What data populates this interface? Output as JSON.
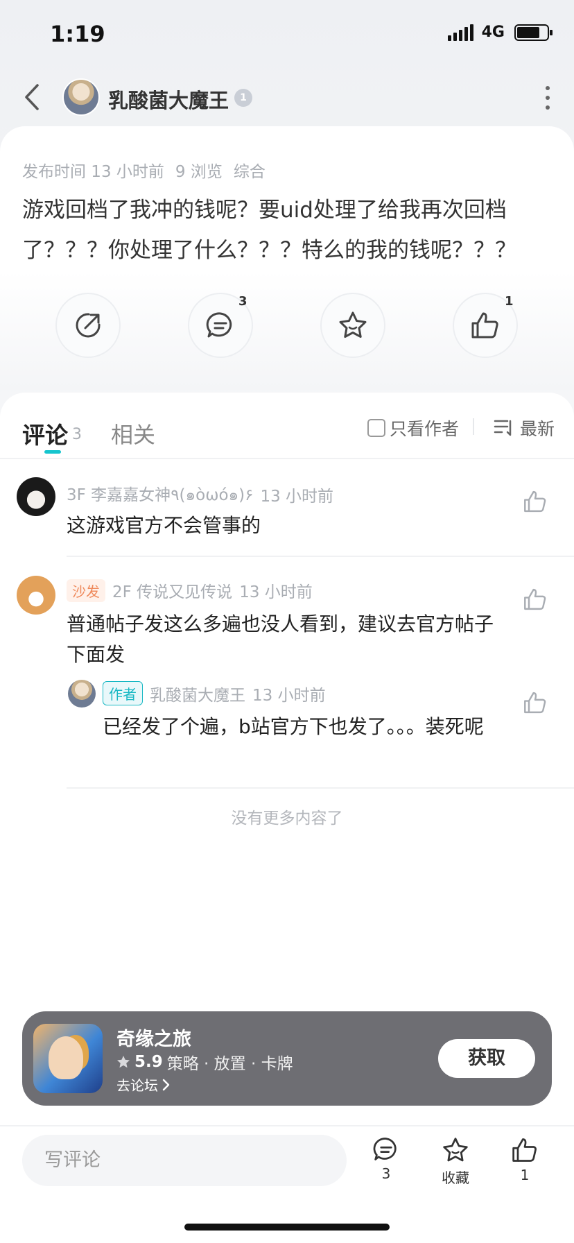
{
  "status_bar": {
    "time": "1:19",
    "network": "4G"
  },
  "header": {
    "author_name": "乳酸菌大魔王",
    "level": "1"
  },
  "post": {
    "meta": {
      "publish": "发布时间 13 小时前",
      "views": "9 浏览",
      "category": "综合"
    },
    "content": "游戏回档了我冲的钱呢？要uid处理了给我再次回档了？？？你处理了什么？？？特么的我的钱呢？？？",
    "actions": {
      "comment_count": "3",
      "like_count": "1"
    }
  },
  "comments_section": {
    "tab_comments": "评论",
    "tab_comments_count": "3",
    "tab_related": "相关",
    "only_author": "只看作者",
    "sort": "最新",
    "comments": [
      {
        "floor_user": "3F 李嘉嘉女神٩(๑òωó๑)۶",
        "time": "13 小时前",
        "text": "这游戏官方不会管事的"
      },
      {
        "tag": "沙发",
        "floor_user": "2F 传说又见传说",
        "time": "13 小时前",
        "text": "普通帖子发这么多遍也没人看到，建议去官方帖子下面发",
        "reply": {
          "tag": "作者",
          "user": "乳酸菌大魔王",
          "time": "13 小时前",
          "text": "已经发了个遍，b站官方下也发了。。。装死呢"
        }
      }
    ],
    "no_more": "没有更多内容了"
  },
  "game_banner": {
    "name": "奇缘之旅",
    "score": "5.9",
    "tags": "策略 · 放置 · 卡牌",
    "forum_link": "去论坛",
    "get_button": "获取"
  },
  "bottom_bar": {
    "input_placeholder": "写评论",
    "comment_count": "3",
    "favorite_label": "收藏",
    "like_count": "1"
  },
  "colors": {
    "accent": "#15c5ce",
    "banner_bg": "#6e6e73",
    "sofa_tag": "#ef8a5c"
  }
}
